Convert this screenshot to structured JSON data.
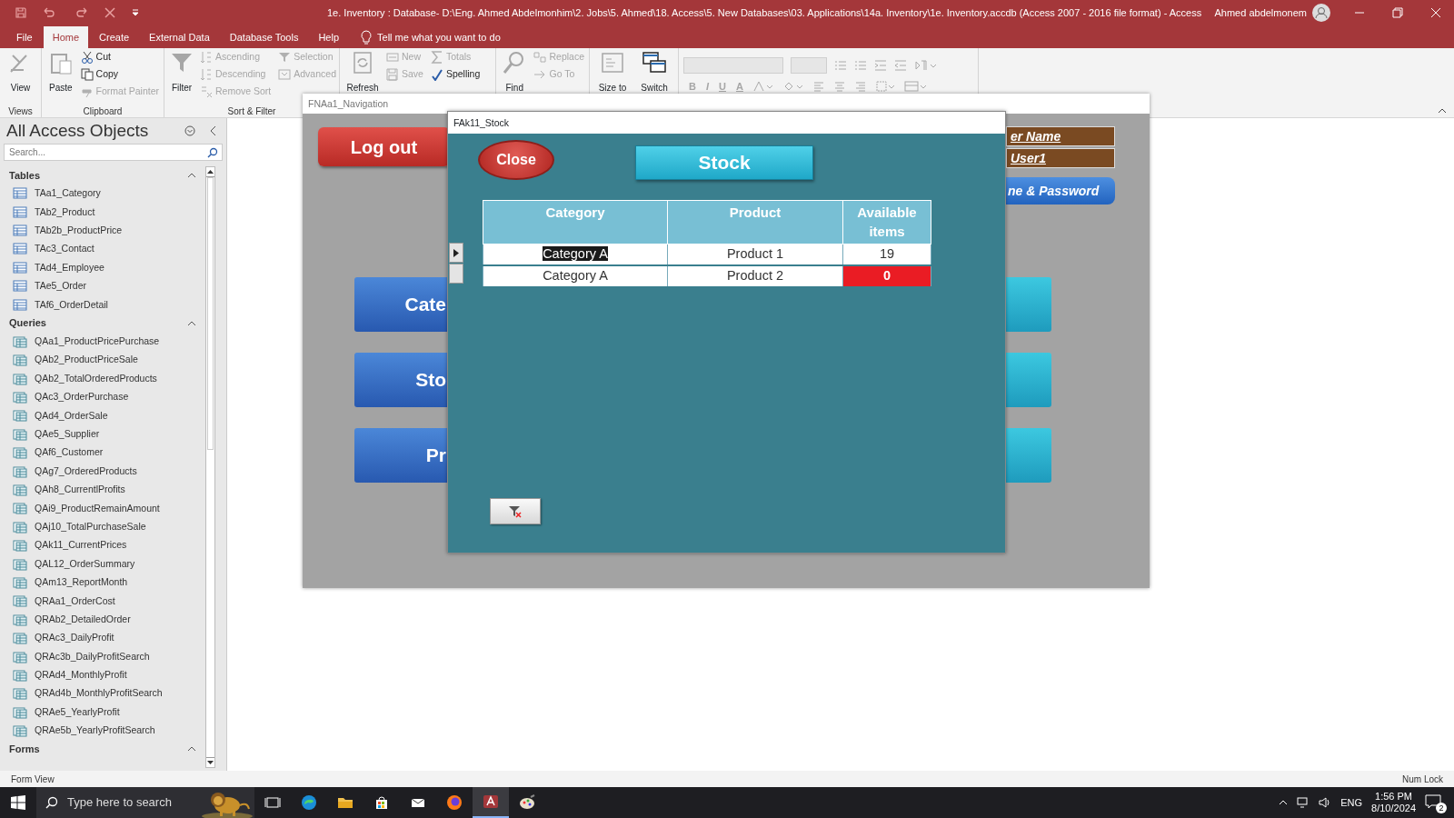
{
  "window": {
    "title": "1e. Inventory : Database- D:\\Eng. Ahmed Abdelmonhim\\2. Jobs\\5. Ahmed\\18. Access\\5. New Databases\\03. Applications\\14a. Inventory\\1e. Inventory.accdb (Access 2007 - 2016 file format)  -  Access",
    "user": "Ahmed abdelmonem"
  },
  "ribbon_tabs": [
    {
      "label": "File",
      "selected": false
    },
    {
      "label": "Home",
      "selected": true
    },
    {
      "label": "Create",
      "selected": false
    },
    {
      "label": "External Data",
      "selected": false
    },
    {
      "label": "Database Tools",
      "selected": false
    },
    {
      "label": "Help",
      "selected": false
    }
  ],
  "tell_me": "Tell me what you want to do",
  "ribbon_groups": [
    {
      "label": "Views",
      "items": [
        {
          "label": "View",
          "kind": "large",
          "disabled": true
        }
      ]
    },
    {
      "label": "Clipboard",
      "items": [
        {
          "label": "Paste",
          "kind": "large",
          "disabled": true
        },
        {
          "label": "Cut",
          "kind": "small",
          "disabled": false
        },
        {
          "label": "Copy",
          "kind": "small",
          "disabled": false
        },
        {
          "label": "Format Painter",
          "kind": "small",
          "disabled": true
        }
      ]
    },
    {
      "label": "Sort & Filter",
      "items": [
        {
          "label": "Filter",
          "kind": "large",
          "disabled": true
        },
        {
          "label": "Ascending",
          "kind": "small",
          "disabled": true
        },
        {
          "label": "Descending",
          "kind": "small",
          "disabled": true
        },
        {
          "label": "Remove Sort",
          "kind": "small",
          "disabled": true
        },
        {
          "label": "Selection",
          "kind": "small",
          "disabled": true
        },
        {
          "label": "Advanced",
          "kind": "small",
          "disabled": true
        }
      ]
    },
    {
      "items": [
        {
          "label": "Refresh",
          "kind": "large",
          "disabled": true
        },
        {
          "label": "New",
          "kind": "small",
          "disabled": true
        },
        {
          "label": "Save",
          "kind": "small",
          "disabled": true
        },
        {
          "label": "Totals",
          "kind": "small",
          "disabled": true
        },
        {
          "label": "Spelling",
          "kind": "small",
          "disabled": false
        }
      ]
    },
    {
      "items": [
        {
          "label": "Find",
          "kind": "large",
          "disabled": true
        },
        {
          "label": "Replace",
          "kind": "small",
          "disabled": true
        },
        {
          "label": "Go To",
          "kind": "small",
          "disabled": true
        }
      ]
    },
    {
      "items": [
        {
          "label": "Size to",
          "kind": "large",
          "disabled": true
        },
        {
          "label": "Switch",
          "kind": "large",
          "disabled": false
        }
      ]
    },
    {
      "kind": "text_formatting",
      "format_buttons": [
        "B",
        "I",
        "U",
        "A"
      ]
    }
  ],
  "nav_pane": {
    "title": "All Access Objects",
    "search_placeholder": "Search...",
    "sections": [
      {
        "label": "Tables",
        "kind": "tables",
        "expanded": true,
        "items": [
          "TAa1_Category",
          "TAb2_Product",
          "TAb2b_ProductPrice",
          "TAc3_Contact",
          "TAd4_Employee",
          "TAe5_Order",
          "TAf6_OrderDetail"
        ]
      },
      {
        "label": "Queries",
        "kind": "queries",
        "expanded": true,
        "items": [
          "QAa1_ProductPricePurchase",
          "QAb2_ProductPriceSale",
          "QAb2_TotalOrderedProducts",
          "QAc3_OrderPurchase",
          "QAd4_OrderSale",
          "QAe5_Supplier",
          "QAf6_Customer",
          "QAg7_OrderedProducts",
          "QAh8_CurrentlProfits",
          "QAi9_ProductRemainAmount",
          "QAj10_TotalPurchaseSale",
          "QAk11_CurrentPrices",
          "QAL12_OrderSummary",
          "QAm13_ReportMonth",
          "QRAa1_OrderCost",
          "QRAb2_DetailedOrder",
          "QRAc3_DailyProfit",
          "QRAc3b_DailyProfitSearch",
          "QRAd4_MonthlyProfit",
          "QRAd4b_MonthlyProfitSearch",
          "QRAe5_YearlyProfit",
          "QRAe5b_YearlyProfitSearch"
        ]
      },
      {
        "label": "Forms",
        "kind": "forms",
        "expanded": true
      }
    ]
  },
  "navigation_form": {
    "title": "FNAa1_Navigation",
    "logout": "Log out",
    "user_label": "er Name",
    "user_value": "User1",
    "change_button": "ne & Password",
    "menu_buttons": [
      "Cate",
      "Sto",
      "Pr"
    ]
  },
  "stock_form": {
    "title": "FAk11_Stock",
    "close": "Close",
    "heading": "Stock",
    "table": {
      "columns": [
        "Category",
        "Product",
        "Available items"
      ],
      "rows": [
        {
          "selected": true,
          "out_of_stock": false,
          "cells": [
            "Category A",
            "Product 1",
            "19"
          ]
        },
        {
          "selected": false,
          "out_of_stock": true,
          "cells": [
            "Category A",
            "Product 2",
            "0"
          ]
        }
      ]
    }
  },
  "status_bar": {
    "left": "Form View",
    "right": "Num Lock"
  },
  "taskbar": {
    "search_placeholder": "Type here to search",
    "apps": [
      {
        "selected": false
      },
      {
        "selected": false
      },
      {
        "selected": false
      },
      {
        "selected": false
      },
      {
        "selected": false
      },
      {
        "selected": false
      },
      {
        "selected": true
      },
      {
        "selected": false
      }
    ],
    "language": "ENG",
    "time": "1:56 PM",
    "date": "8/10/2024",
    "notifications": "2"
  }
}
